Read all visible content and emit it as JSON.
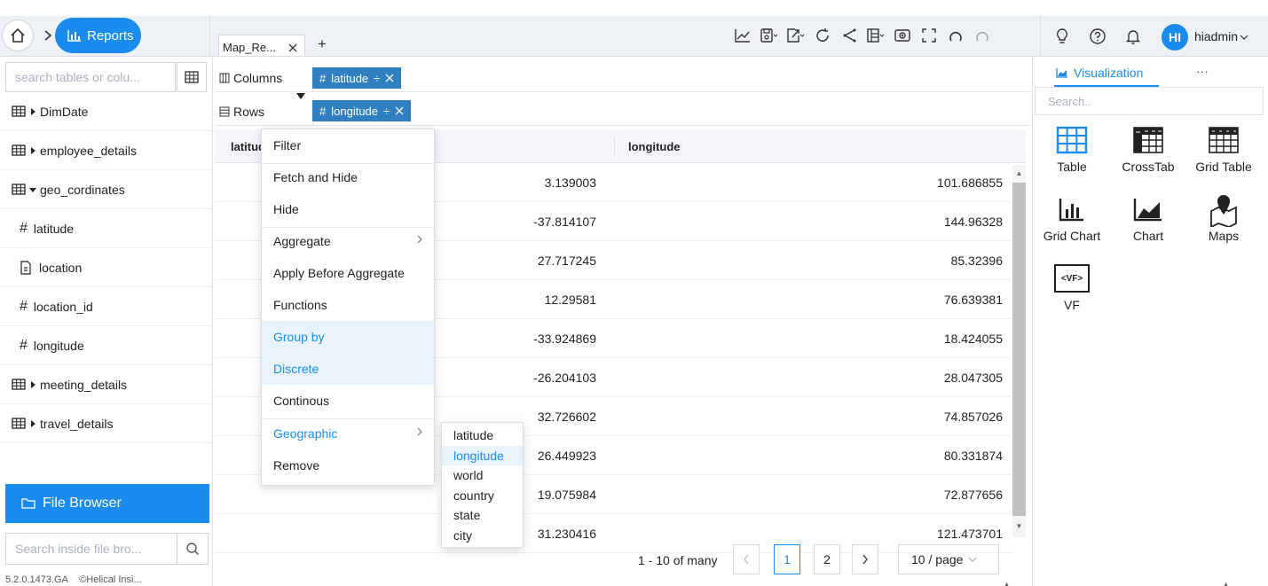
{
  "header": {
    "reports_label": "Reports",
    "tab_name": "Map_Re...",
    "add_tab": "+",
    "user_initials": "HI",
    "user_name": "hiadmin"
  },
  "left_panel": {
    "search_placeholder": "search tables or colu...",
    "tree": [
      {
        "label": "DimDate",
        "type": "table",
        "expanded": false
      },
      {
        "label": "employee_details",
        "type": "table",
        "expanded": false
      },
      {
        "label": "geo_cordinates",
        "type": "table",
        "expanded": true
      },
      {
        "label": "latitude",
        "type": "number"
      },
      {
        "label": "location",
        "type": "text"
      },
      {
        "label": "location_id",
        "type": "number"
      },
      {
        "label": "longitude",
        "type": "number"
      },
      {
        "label": "meeting_details",
        "type": "table",
        "expanded": false
      },
      {
        "label": "travel_details",
        "type": "table",
        "expanded": false
      }
    ],
    "file_browser_label": "File Browser",
    "file_search_placeholder": "Search inside file bro...",
    "version_text": "5.2.0.1473.GA",
    "copyright_text": "©Helical Insi..."
  },
  "shelves": {
    "columns_label": "Columns",
    "rows_label": "Rows",
    "column_pill": "latitude",
    "row_pill": "longitude"
  },
  "table": {
    "headers": [
      "latitude",
      "longitude"
    ],
    "rows": [
      [
        "3.139003",
        "101.686855"
      ],
      [
        "-37.814107",
        "144.96328"
      ],
      [
        "27.717245",
        "85.32396"
      ],
      [
        "12.29581",
        "76.639381"
      ],
      [
        "-33.924869",
        "18.424055"
      ],
      [
        "-26.204103",
        "28.047305"
      ],
      [
        "32.726602",
        "74.857026"
      ],
      [
        "26.449923",
        "80.331874"
      ],
      [
        "19.075984",
        "72.877656"
      ],
      [
        "31.230416",
        "121.473701"
      ]
    ]
  },
  "pagination": {
    "summary": "1 - 10 of many",
    "pages": [
      "1",
      "2"
    ],
    "page_size": "10 / page"
  },
  "context_menu": {
    "items": [
      "Filter",
      "Fetch and Hide",
      "Hide",
      "Aggregate",
      "Apply Before Aggregate",
      "Functions",
      "Group by",
      "Discrete",
      "Continous",
      "Geographic",
      "Remove"
    ],
    "submenu": [
      "latitude",
      "longitude",
      "world",
      "country",
      "state",
      "city"
    ]
  },
  "right_panel": {
    "tab_label": "Visualization",
    "more": "···",
    "search_placeholder": "Search..",
    "viz_types": [
      "Table",
      "CrossTab",
      "Grid Table",
      "Grid Chart",
      "Chart",
      "Maps",
      "VF"
    ],
    "vf_badge": "<VF>"
  },
  "colors": {
    "accent": "#1a8cf0",
    "pill": "#2f7fc1",
    "highlight": "#e8f3fc"
  }
}
